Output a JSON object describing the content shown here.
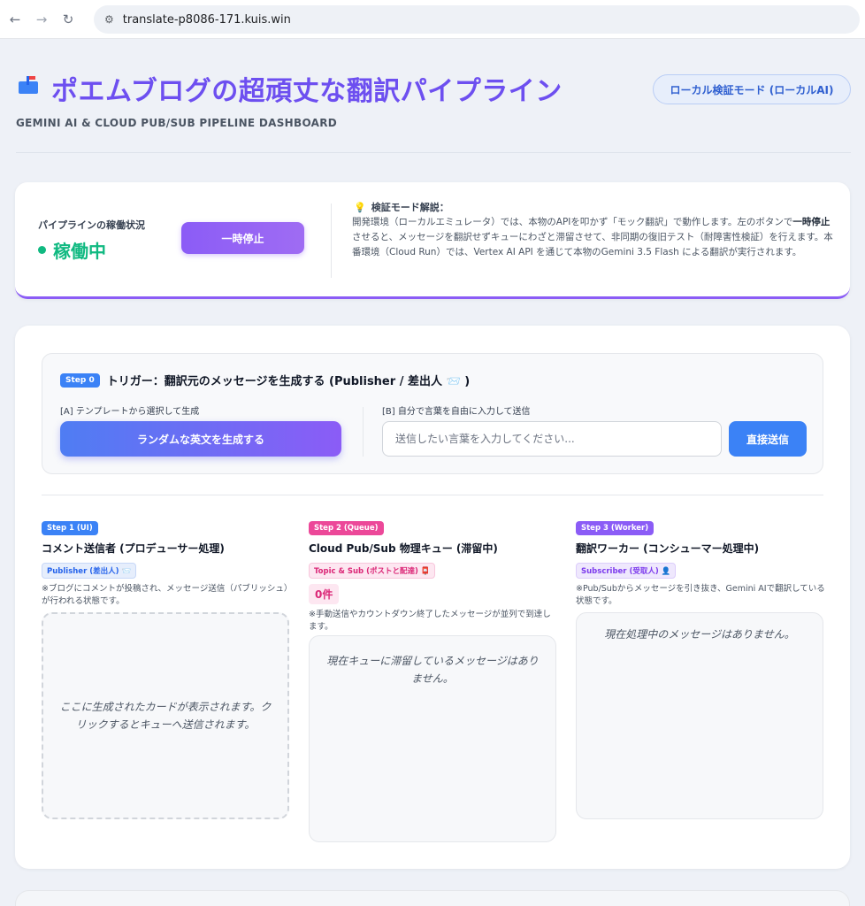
{
  "browser": {
    "url": "translate-p8086-171.kuis.win"
  },
  "header": {
    "title": "ポエムブログの超頑丈な翻訳パイプライン",
    "subtitle": "GEMINI AI & CLOUD PUB/SUB PIPELINE DASHBOARD",
    "mode_badge": "ローカル検証モード (ローカルAI)"
  },
  "status": {
    "label": "パイプラインの稼働状況",
    "value": "稼働中",
    "pause_button": "一時停止",
    "info_title": "検証モード解説：",
    "info_text_1": "開発環境（ローカルエミュレータ）では、本物のAPIを叩かず「モック翻訳」で動作します。左のボタンで",
    "info_text_bold": "一時停止",
    "info_text_2": "させると、メッセージを翻訳せずキューにわざと滞留させて、非同期の復旧テスト（耐障害性検証）を行えます。本番環境（Cloud Run）では、Vertex AI API を通じて本物のGemini 3.5 Flash による翻訳が実行されます。"
  },
  "step0": {
    "badge": "Step 0",
    "title": "トリガー：翻訳元のメッセージを生成する (Publisher / 差出人 📨 )",
    "option_a_label": "[A] テンプレートから選択して生成",
    "random_button": "ランダムな英文を生成する",
    "option_b_label": "[B] 自分で言葉を自由に入力して送信",
    "input_placeholder": "送信したい言葉を入力してください...",
    "send_button": "直接送信"
  },
  "columns": {
    "step1": {
      "badge": "Step 1 (UI)",
      "title": "コメント送信者 (プロデューサー処理)",
      "role": "Publisher (差出人) 📨",
      "note": "※ブログにコメントが投稿され、メッセージ送信（パブリッシュ）が行われる状態です。",
      "empty_text": "ここに生成されたカードが表示されます。クリックするとキューへ送信されます。"
    },
    "step2": {
      "badge": "Step 2 (Queue)",
      "title": "Cloud Pub/Sub 物理キュー (滞留中)",
      "role": "Topic & Sub (ポストと配達) 📮",
      "count": "0件",
      "note": "※手動送信やカウントダウン終了したメッセージが並列で到達します。",
      "empty_text": "現在キューに滞留しているメッセージはありません。"
    },
    "step3": {
      "badge": "Step 3 (Worker)",
      "title": "翻訳ワーカー (コンシューマー処理中)",
      "role": "Subscriber (受取人) 👤",
      "note": "※Pub/Subからメッセージを引き抜き、Gemini AIで翻訳している状態です。",
      "empty_text": "現在処理中のメッセージはありません。"
    }
  },
  "colors": {
    "accent_purple": "#8b5cf6",
    "accent_blue": "#3b82f6",
    "accent_pink": "#ec4899",
    "status_green": "#10b981"
  }
}
